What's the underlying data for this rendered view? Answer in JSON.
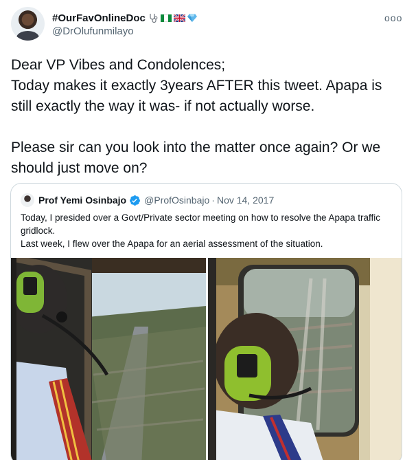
{
  "author": {
    "display_name": "#OurFavOnlineDoc",
    "handle": "@DrOlufunmilayo",
    "badge_icons": [
      "stethoscope-emoji",
      "nigeria-flag-emoji",
      "uk-flag-emoji",
      "gem-emoji"
    ]
  },
  "menu": {
    "more_label": "ooo"
  },
  "tweet": {
    "paragraph_1_line_1": "Dear VP Vibes and Condolences;",
    "paragraph_1_line_2": "Today makes it exactly 3years AFTER this tweet. Apapa is still exactly the way it was- if not actually worse.",
    "paragraph_2": "Please sir can you look into the matter once again? Or we should just move on?"
  },
  "quoted_tweet": {
    "display_name": "Prof Yemi Osinbajo",
    "handle": "@ProfOsinbajo",
    "separator": "·",
    "date": "Nov 14, 2017",
    "text_line_1": "Today, I presided over a Govt/Private sector meeting on how to resolve the Apapa traffic gridlock.",
    "text_line_2": "Last week, I flew over the Apapa for an aerial assessment of the situation.",
    "media": [
      "aerial-photo-helicopter-left",
      "aerial-photo-helicopter-right"
    ]
  },
  "colors": {
    "text_primary": "#0f1419",
    "text_secondary": "#536471",
    "border": "#cfd9de",
    "verified_blue": "#1d9bf0"
  }
}
